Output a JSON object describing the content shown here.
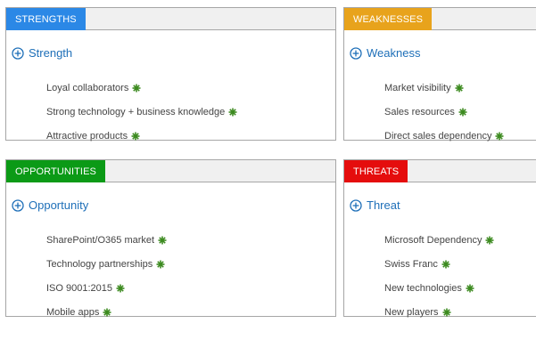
{
  "colors": {
    "strengths": "#2b88e6",
    "weaknesses": "#e8a31c",
    "opportunities": "#0b9a16",
    "threats": "#e50d0d",
    "link": "#1e6fb8",
    "item_icon": "#3c8a1f"
  },
  "icons": {
    "add": "plus-circle-icon",
    "item": "asterisk-icon"
  },
  "strengths": {
    "title": "STRENGTHS",
    "add_label": "Strength",
    "items": [
      "Loyal collaborators",
      "Strong technology + business knowledge",
      "Attractive products"
    ]
  },
  "weaknesses": {
    "title": "WEAKNESSES",
    "add_label": "Weakness",
    "items": [
      "Market visibility",
      "Sales resources",
      "Direct sales dependency"
    ]
  },
  "opportunities": {
    "title": "OPPORTUNITIES",
    "add_label": "Opportunity",
    "items": [
      "SharePoint/O365 market",
      "Technology partnerships",
      "ISO 9001:2015",
      "Mobile apps"
    ]
  },
  "threats": {
    "title": "THREATS",
    "add_label": "Threat",
    "items": [
      "Microsoft Dependency",
      "Swiss Franc",
      "New technologies",
      "New players"
    ]
  }
}
